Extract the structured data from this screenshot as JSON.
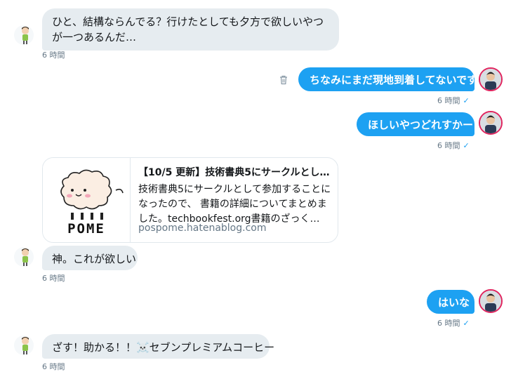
{
  "messages": [
    {
      "text": "ひと、結構ならんでる？行けたとしても夕方で欲しいやつが一つあるんだ…",
      "time": "6 時間"
    },
    {
      "text": "ちなみにまだ現地到着してないです",
      "time": "6 時間"
    },
    {
      "text": "ほしいやつどれすかー",
      "time": "6 時間"
    },
    {
      "text": "神。これが欲しい",
      "time": "6 時間"
    },
    {
      "text": "はいな",
      "time": "6 時間"
    },
    {
      "text": "ざす！助かる！！☠️セブンプレミアムコーヒー",
      "time": "6 時間"
    }
  ],
  "card": {
    "title": "【10/5 更新】技術書典5にサークルとし…",
    "description": "技術書典5にサークルとして参加することになったので、 書籍の詳細についてまとめました。techbookfest.org書籍のざっく…",
    "domain": "pospome.hatenablog.com",
    "logo_text": "POME"
  },
  "icons": {
    "read": "check-icon",
    "delete": "trash-icon"
  },
  "colors": {
    "outgoing_bubble": "#1da1f2",
    "incoming_bubble": "#e6ecf0",
    "meta_text": "#657786"
  }
}
